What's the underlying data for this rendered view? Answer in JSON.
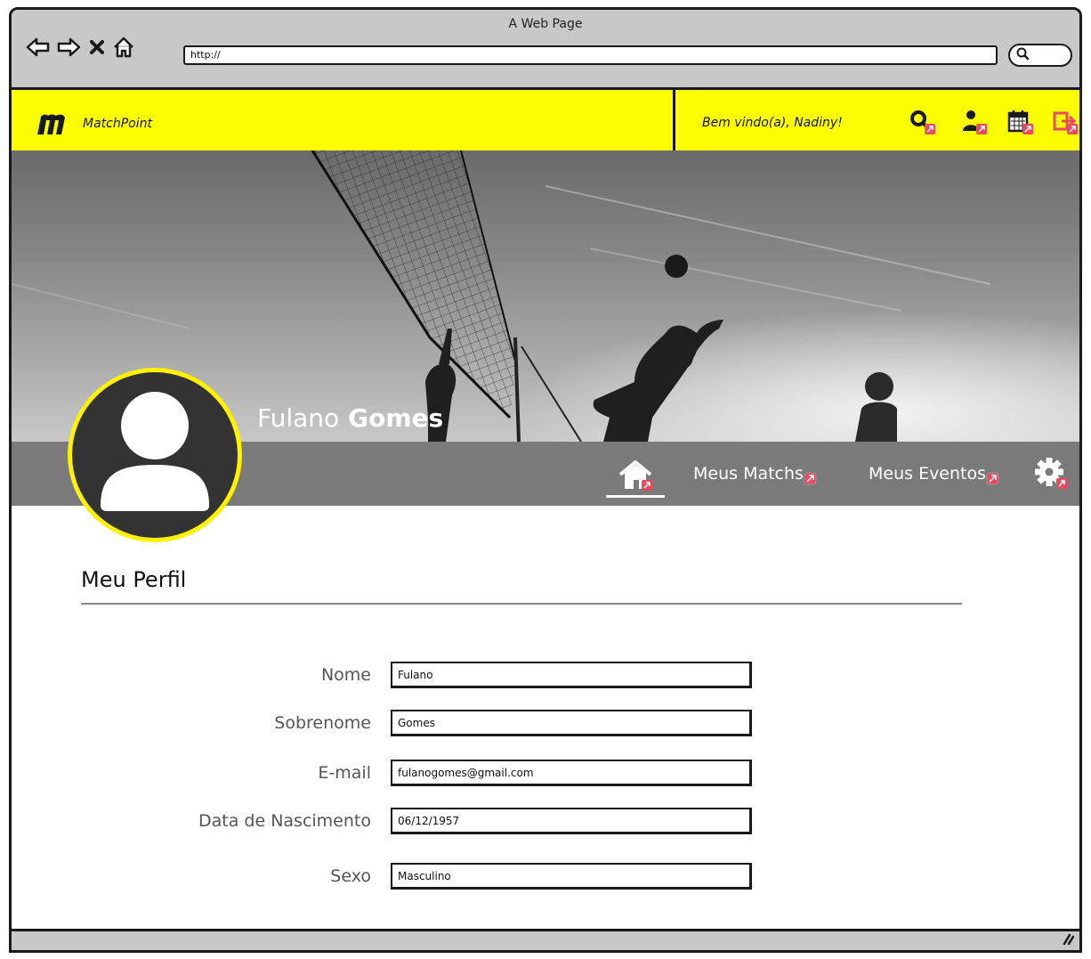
{
  "browser": {
    "title": "A Web Page",
    "url": "http://"
  },
  "app": {
    "name": "MatchPoint",
    "welcome": "Bem vindo(a), Nadiny!",
    "accent": "#fdfd02"
  },
  "profile": {
    "first_name": "Fulano",
    "last_name": "Gomes",
    "ring_color": "#fff200"
  },
  "tabs": [
    {
      "label": "Meus Matchs"
    },
    {
      "label": "Meus Eventos"
    }
  ],
  "section": {
    "title": "Meu Perfil"
  },
  "form": {
    "fields": [
      {
        "label": "Nome",
        "value": "Fulano"
      },
      {
        "label": "Sobrenome",
        "value": "Gomes"
      },
      {
        "label": "E-mail",
        "value": "fulanogomes@gmail.com"
      },
      {
        "label": "Data de Nascimento",
        "value": "06/12/1957"
      },
      {
        "label": "Sexo",
        "value": "Masculino"
      }
    ]
  },
  "icons": [
    "back-icon",
    "forward-icon",
    "stop-icon",
    "home-icon",
    "search-icon",
    "logo-icon",
    "search-user-icon",
    "profile-icon",
    "calendar-icon",
    "logout-icon",
    "home-tab-icon",
    "settings-gear-icon",
    "link-badge-icon",
    "resize-grip-icon"
  ]
}
